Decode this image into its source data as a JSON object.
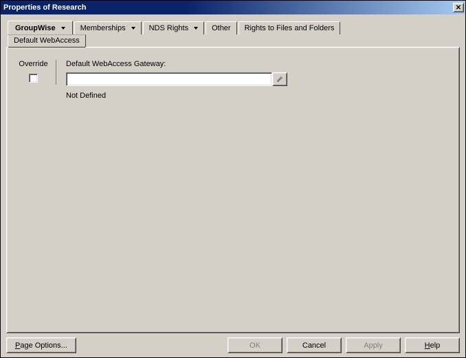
{
  "title": "Properties of Research",
  "tabs": {
    "groupwise": "GroupWise",
    "memberships": "Memberships",
    "nds_rights": "NDS Rights",
    "other": "Other",
    "rights_files": "Rights to Files and Folders"
  },
  "subtabs": {
    "default_webaccess": "Default WebAccess"
  },
  "form": {
    "override_label": "Override",
    "gateway_label": "Default WebAccess Gateway:",
    "gateway_value": "",
    "status": "Not Defined"
  },
  "buttons": {
    "page_options_pre": "P",
    "page_options_post": "age Options...",
    "ok": "OK",
    "cancel": "Cancel",
    "apply": "Apply",
    "help_pre": "H",
    "help_post": "elp"
  }
}
